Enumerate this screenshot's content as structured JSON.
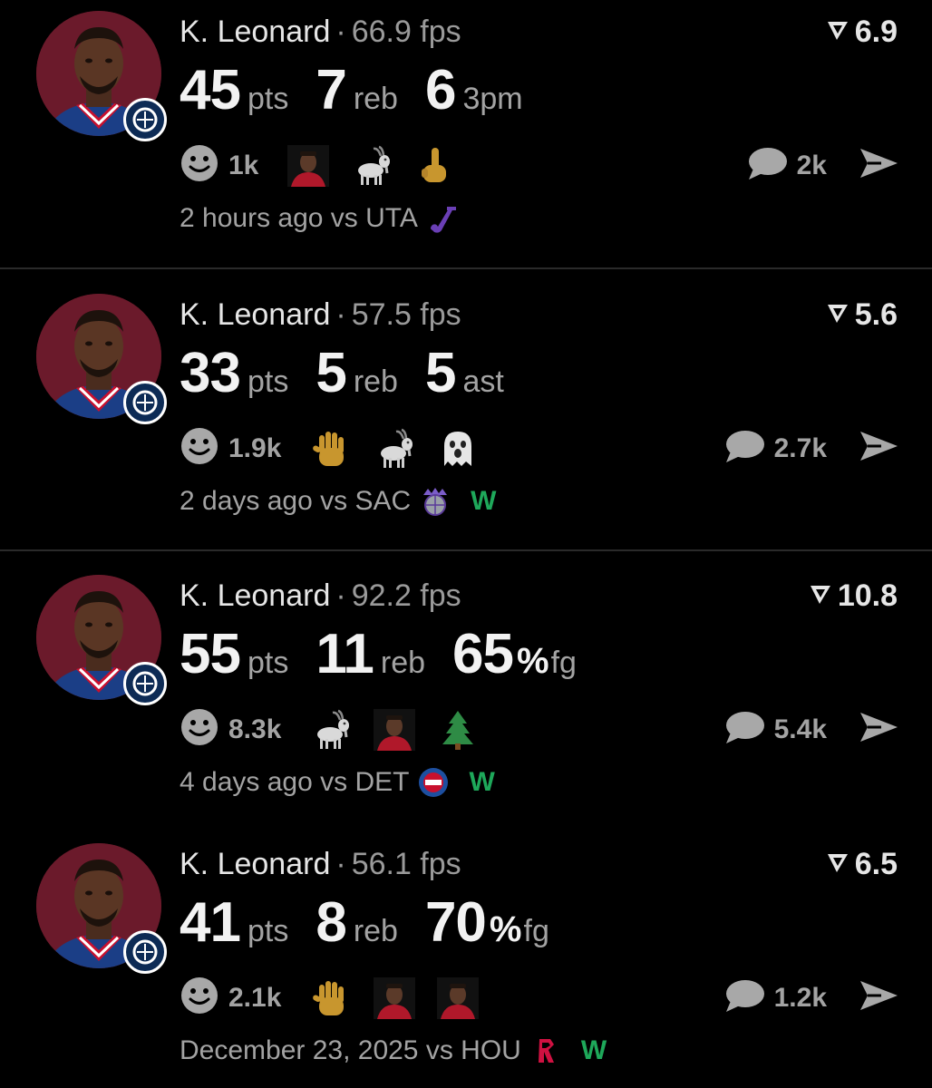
{
  "posts": [
    {
      "player": "K. Leonard",
      "fps": "66.9 fps",
      "rating": "6.9",
      "stats": [
        {
          "value": "45",
          "unit": "pts"
        },
        {
          "value": "7",
          "unit": "reb"
        },
        {
          "value": "6",
          "unit": "3pm"
        }
      ],
      "smile_count": "1k",
      "reactions": [
        "player-photo-emoji",
        "goat-emoji",
        "middle-finger-emoji"
      ],
      "comment_count": "2k",
      "time": "2 hours ago vs UTA",
      "opponent_logo": "jazz-note-icon",
      "result": ""
    },
    {
      "player": "K. Leonard",
      "fps": "57.5 fps",
      "rating": "5.6",
      "stats": [
        {
          "value": "33",
          "unit": "pts"
        },
        {
          "value": "5",
          "unit": "reb"
        },
        {
          "value": "5",
          "unit": "ast"
        }
      ],
      "smile_count": "1.9k",
      "reactions": [
        "raised-hand-emoji",
        "goat-emoji",
        "ghost-emoji"
      ],
      "comment_count": "2.7k",
      "time": "2 days ago vs SAC",
      "opponent_logo": "kings-logo-icon",
      "result": "W"
    },
    {
      "player": "K. Leonard",
      "fps": "92.2 fps",
      "rating": "10.8",
      "stats": [
        {
          "value": "55",
          "unit": "pts"
        },
        {
          "value": "11",
          "unit": "reb"
        },
        {
          "value": "65",
          "pct": "%",
          "unit": "fg"
        }
      ],
      "smile_count": "8.3k",
      "reactions": [
        "goat-emoji",
        "player-photo-emoji",
        "evergreen-tree-emoji"
      ],
      "comment_count": "5.4k",
      "time": "4 days ago vs DET",
      "opponent_logo": "pistons-logo-icon",
      "result": "W"
    },
    {
      "player": "K. Leonard",
      "fps": "56.1 fps",
      "rating": "6.5",
      "stats": [
        {
          "value": "41",
          "unit": "pts"
        },
        {
          "value": "8",
          "unit": "reb"
        },
        {
          "value": "70",
          "pct": "%",
          "unit": "fg"
        }
      ],
      "smile_count": "2.1k",
      "reactions": [
        "raised-hand-emoji",
        "player-photo-emoji",
        "player-photo-emoji"
      ],
      "comment_count": "1.2k",
      "time": "December 23, 2025 vs HOU",
      "opponent_logo": "rockets-logo-icon",
      "result": "W"
    }
  ],
  "colors": {
    "background": "#000000",
    "win": "#1ea85a",
    "muted": "#a3a3a3",
    "avatar_bg": "#6b1a2b"
  }
}
